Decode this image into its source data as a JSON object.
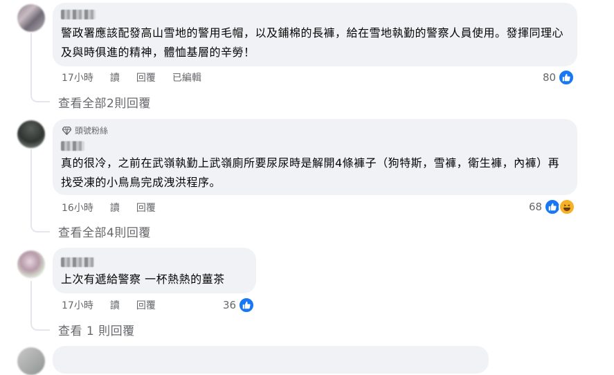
{
  "comments": [
    {
      "text": "警政署應該配發高山雪地的警用毛帽，以及鋪棉的長褲，給在雪地執勤的警察人員使用。發揮同理心及與時俱進的精神，體恤基層的辛勞！",
      "time": "17小時",
      "read": "讀",
      "reply": "回覆",
      "edited": "已編輯",
      "reactions": "80",
      "view_replies": "查看全部2則回覆"
    },
    {
      "badge": "頭號粉絲",
      "text": "真的很冷，之前在武嶺執勤上武嶺廁所要尿尿時是解開4條褲子（狗特斯，雪褲，衛生褲，內褲）再找受凍的小鳥鳥完成洩洪程序。",
      "time": "16小時",
      "read": "讀",
      "reply": "回覆",
      "reactions": "68",
      "view_replies": "查看全部4則回覆"
    },
    {
      "text": "上次有遞給警察 一杯熱熱的薑茶",
      "time": "17小時",
      "read": "讀",
      "reply": "回覆",
      "reactions": "36",
      "view_replies": "查看 1 則回覆"
    }
  ],
  "colors": {
    "bubble": "#f0f2f5",
    "meta_text": "#65676b",
    "like_blue": "#1877f2",
    "haha_yellow": "#f7b125"
  },
  "icons": [
    "like-icon",
    "haha-icon",
    "top-fan-icon"
  ]
}
